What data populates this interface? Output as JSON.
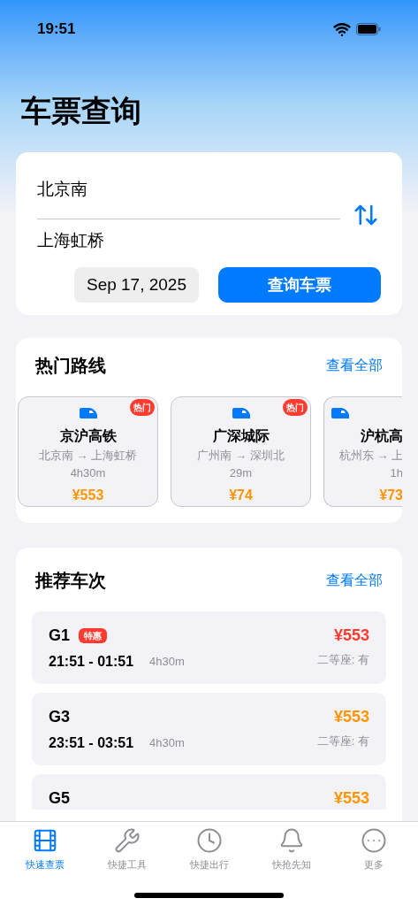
{
  "status_bar": {
    "time": "19:51"
  },
  "title": "车票查询",
  "search": {
    "from": "北京南",
    "to": "上海虹桥",
    "date": "Sep 17, 2025",
    "button": "查询车票"
  },
  "hot_routes": {
    "title": "热门路线",
    "link": "查看全部",
    "items": [
      {
        "name": "京沪高铁",
        "route": "北京南 → 上海虹桥",
        "duration": "4h30m",
        "price": "¥553",
        "badge": "热门",
        "clipped": false
      },
      {
        "name": "广深城际",
        "route": "广州南 → 深圳北",
        "duration": "29m",
        "price": "¥74",
        "badge": "热门",
        "clipped": false
      },
      {
        "name": "沪杭高",
        "route": "杭州东 → 上",
        "duration": "1h",
        "price": "¥73",
        "clipped": true
      }
    ]
  },
  "trains": {
    "title": "推荐车次",
    "link": "查看全部",
    "items": [
      {
        "code": "G1",
        "badge": "特惠",
        "times": "21:51 - 01:51",
        "duration": "4h30m",
        "price": "¥553",
        "color": "#ff3b30",
        "seats": "二等座: 有"
      },
      {
        "code": "G3",
        "times": "23:51 - 03:51",
        "duration": "4h30m",
        "price": "¥553",
        "color": "#ff9500",
        "seats": "二等座: 有"
      },
      {
        "code": "G5",
        "price": "¥553",
        "color": "#ff9500"
      }
    ]
  },
  "tab_bar": [
    {
      "label": "快速查票",
      "selected": true
    },
    {
      "label": "快捷工具",
      "selected": false
    },
    {
      "label": "快捷出行",
      "selected": false
    },
    {
      "label": "快抢先知",
      "selected": false
    },
    {
      "label": "更多",
      "selected": false
    }
  ]
}
